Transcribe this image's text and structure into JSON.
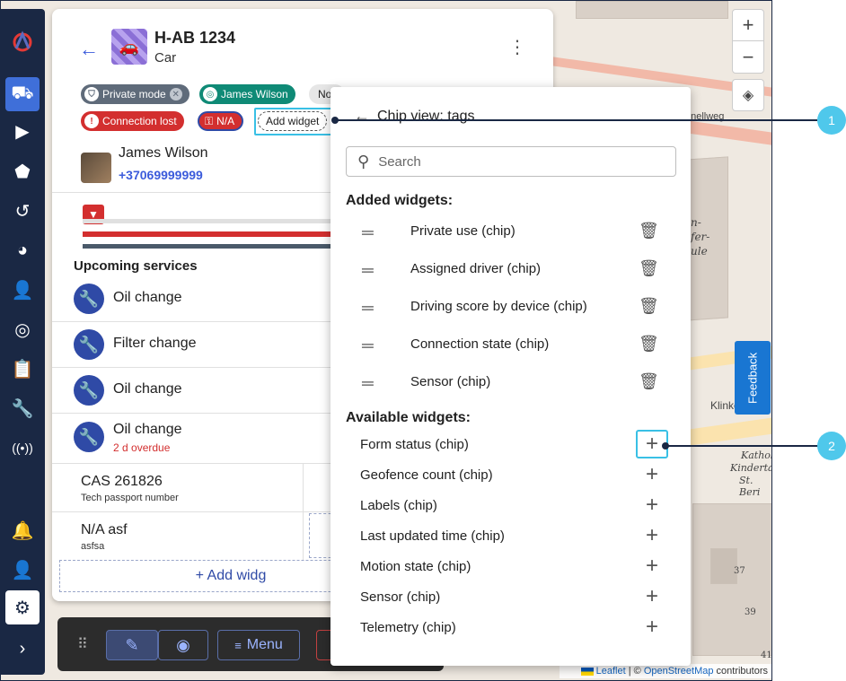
{
  "vehicle": {
    "title": "H-AB 1234",
    "subtitle": "Car"
  },
  "chips": {
    "private_mode": "Private mode",
    "driver": "James Wilson",
    "partial": "No",
    "connection": "Connection lost",
    "na": "N/A",
    "add_widget": "Add widget"
  },
  "driver": {
    "name": "James Wilson",
    "phone": "+37069999999"
  },
  "services": {
    "title": "Upcoming services",
    "items": [
      {
        "label": "Oil change"
      },
      {
        "label": "Filter change"
      },
      {
        "label": "Oil change"
      },
      {
        "label": "Oil change",
        "note": "2 d overdue"
      }
    ]
  },
  "info": {
    "cell1_value": "CAS 261826",
    "cell1_label": "Tech passport number",
    "cell2_value": "N/A asf",
    "cell2_label": "asfsa",
    "add_widget": "+ Add widg"
  },
  "toolbar": {
    "menu_label": "Menu"
  },
  "popup": {
    "title": "Chip view: tags",
    "search_placeholder": "Search",
    "added_heading": "Added widgets:",
    "added": [
      "Private use (chip)",
      "Assigned driver (chip)",
      "Driving score by device (chip)",
      "Connection state (chip)",
      "Sensor (chip)"
    ],
    "available_heading": "Available widgets:",
    "available": [
      "Form status (chip)",
      "Geofence count (chip)",
      "Labels (chip)",
      "Last updated time (chip)",
      "Motion state (chip)",
      "Sensor (chip)",
      "Telemetry (chip)"
    ]
  },
  "callouts": [
    "1",
    "2"
  ],
  "map": {
    "street": "hnellweg",
    "street2": "Klinke",
    "school": [
      "n-",
      "fer-",
      "ule"
    ],
    "kita": [
      "Kathol",
      "Kindertag",
      "St. Beri"
    ],
    "house_numbers": [
      "37",
      "39",
      "41"
    ],
    "feedback": "Feedback",
    "attribution_leaflet": "Leaflet",
    "attribution_sep": " | © ",
    "attribution_osm": "OpenStreetMap",
    "attribution_tail": " contributors"
  },
  "colors": {
    "sidebar": "#1a2844",
    "accent": "#3b5bdb",
    "chip_private": "#5f6b7a",
    "chip_driver": "#0f8a76",
    "chip_connection": "#d32f2f",
    "callout": "#4fc8eb"
  }
}
